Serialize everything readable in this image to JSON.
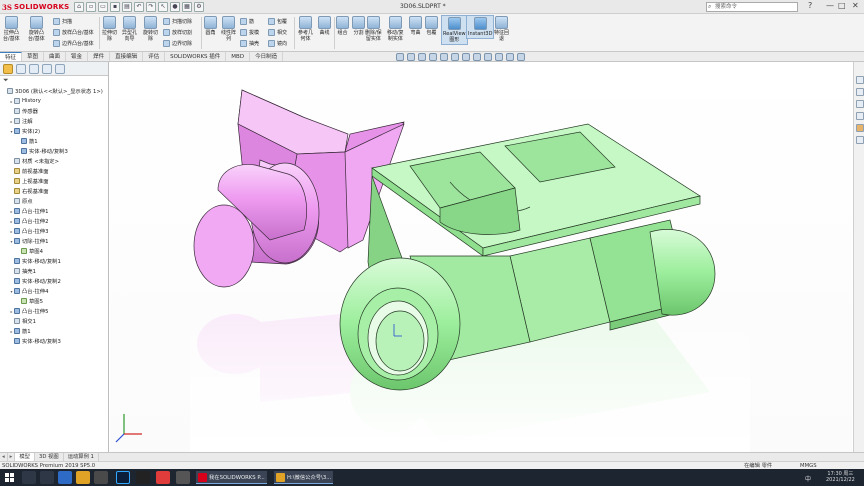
{
  "titlebar": {
    "app_logo_ds": "3S",
    "app_logo_text": "SOLIDWORKS",
    "document": "3D06.SLDPRT *",
    "search_placeholder": "搜索命令",
    "min": "—",
    "max": "□",
    "close": "✕"
  },
  "ribbon": {
    "extrude_boss": "拉伸凸\n台/基体",
    "revolve_boss": "旋转凸\n台/基体",
    "sweep": "扫描",
    "loft": "放样凸台/基体",
    "boundary": "边界凸台/基体",
    "extrude_cut": "拉伸切\n除",
    "hole_wizard": "异型孔\n向导",
    "revolve_cut": "旋转切\n除",
    "loft_cut": "放样切割",
    "sweep_cut": "扫描切除",
    "boundary_cut": "边界切除",
    "fillet": "圆角",
    "linear_pattern": "线性阵\n列",
    "rib": "筋",
    "wrap": "包覆",
    "draft": "拔模",
    "intersect": "相交",
    "shell": "抽壳",
    "mirror": "镜向",
    "reference_geometry": "参考几\n何体",
    "curves": "曲线",
    "combine": "组合",
    "split": "分割",
    "delete_keep": "删除/保\n留实体",
    "move_copy": "移动/复\n制实体",
    "flex": "弯曲",
    "wrap2": "包覆",
    "realview": "RealView\n图形",
    "instant3d": "Instant3D",
    "rollback": "特征回\n退"
  },
  "tabs": [
    "特征",
    "草图",
    "曲面",
    "钣金",
    "焊件",
    "直接编辑",
    "评估",
    "SOLIDWORKS 插件",
    "MBD",
    "今日制造"
  ],
  "tree": {
    "filter_icon": "funnel-icon",
    "items": [
      {
        "label": "3D06  (默认<<默认>_显示状态 1>)",
        "indent": 0,
        "toggle": ""
      },
      {
        "label": "History",
        "indent": 1,
        "toggle": "▸"
      },
      {
        "label": "传感器",
        "indent": 1,
        "toggle": ""
      },
      {
        "label": "注解",
        "indent": 1,
        "toggle": "▸"
      },
      {
        "label": "实体(2)",
        "indent": 1,
        "toggle": "▾"
      },
      {
        "label": "筋1",
        "indent": 2,
        "toggle": ""
      },
      {
        "label": "实体-移动/复制3",
        "indent": 2,
        "toggle": ""
      },
      {
        "label": "材质 <未指定>",
        "indent": 1,
        "toggle": ""
      },
      {
        "label": "前视基准面",
        "indent": 1,
        "toggle": ""
      },
      {
        "label": "上视基准面",
        "indent": 1,
        "toggle": ""
      },
      {
        "label": "右视基准面",
        "indent": 1,
        "toggle": ""
      },
      {
        "label": "原点",
        "indent": 1,
        "toggle": ""
      },
      {
        "label": "凸台-拉伸1",
        "indent": 1,
        "toggle": "▸"
      },
      {
        "label": "凸台-拉伸2",
        "indent": 1,
        "toggle": "▸"
      },
      {
        "label": "凸台-拉伸3",
        "indent": 1,
        "toggle": "▸"
      },
      {
        "label": "切除-拉伸1",
        "indent": 1,
        "toggle": "▾"
      },
      {
        "label": "草图4",
        "indent": 2,
        "toggle": ""
      },
      {
        "label": "实体-移动/复制1",
        "indent": 1,
        "toggle": ""
      },
      {
        "label": "抽壳1",
        "indent": 1,
        "toggle": ""
      },
      {
        "label": "实体-移动/复制2",
        "indent": 1,
        "toggle": ""
      },
      {
        "label": "凸台-拉伸4",
        "indent": 1,
        "toggle": "▾"
      },
      {
        "label": "草图5",
        "indent": 2,
        "toggle": ""
      },
      {
        "label": "凸台-拉伸5",
        "indent": 1,
        "toggle": "▸"
      },
      {
        "label": "相交1",
        "indent": 1,
        "toggle": ""
      },
      {
        "label": "筋1",
        "indent": 1,
        "toggle": "▸"
      },
      {
        "label": "实体-移动/复制3",
        "indent": 1,
        "toggle": ""
      }
    ]
  },
  "bottom_tabs": [
    "◂",
    "▸",
    "模型",
    "3D 视图",
    "运动算例 1"
  ],
  "status": {
    "left": "SOLIDWORKS Premium 2019 SP5.0",
    "editing": "在编辑 零件",
    "units": "MMGS"
  },
  "taskbar": {
    "item1": "我在SOLIDWORKS P...",
    "item2": "H:\\微信公众号\\3...",
    "lang": "中",
    "time": "17:30 周三",
    "date": "2021/12/22"
  },
  "colors": {
    "pink_body": "#ee9bf0",
    "green_body": "#a6f2a6",
    "accent": "#3c7fc1"
  }
}
